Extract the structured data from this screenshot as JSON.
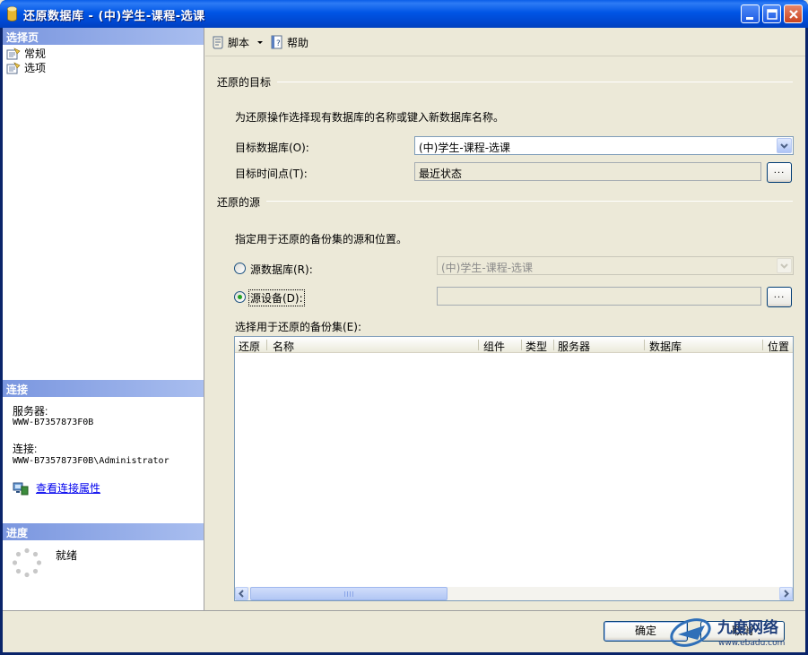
{
  "window": {
    "title": "还原数据库 - (中)学生-课程-选课"
  },
  "left": {
    "select_page_header": "选择页",
    "pages": [
      {
        "label": "常规"
      },
      {
        "label": "选项"
      }
    ],
    "connection_header": "连接",
    "server_label": "服务器:",
    "server_value": "WWW-B7357873F0B",
    "connection_label": "连接:",
    "connection_value": "WWW-B7357873F0B\\Administrator",
    "view_props_link": "查看连接属性",
    "progress_header": "进度",
    "progress_status": "就绪"
  },
  "toolbar": {
    "script_label": "脚本",
    "help_label": "帮助"
  },
  "target": {
    "group_title": "还原的目标",
    "instruction": "为还原操作选择现有数据库的名称或键入新数据库名称。",
    "db_label": "目标数据库(O):",
    "db_value": "(中)学生-课程-选课",
    "time_label": "目标时间点(T):",
    "time_value": "最近状态",
    "ellipsis": "..."
  },
  "source": {
    "group_title": "还原的源",
    "instruction": "指定用于还原的备份集的源和位置。",
    "from_db_label": "源数据库(R):",
    "from_db_value": "(中)学生-课程-选课",
    "from_device_label": "源设备(D):",
    "from_device_value": "",
    "ellipsis": "..."
  },
  "backup_sets": {
    "label": "选择用于还原的备份集(E):",
    "columns": [
      "还原",
      "名称",
      "组件",
      "类型",
      "服务器",
      "数据库",
      "位置"
    ]
  },
  "buttons": {
    "ok": "确定",
    "cancel": "取消"
  },
  "watermark": {
    "text": "九度网络",
    "url": "www.ebadu.com"
  },
  "colors": {
    "title_bar": "#0055E5",
    "section_header": "#7A96DF",
    "link": "#0000EE",
    "radio_dot": "#21A121"
  }
}
